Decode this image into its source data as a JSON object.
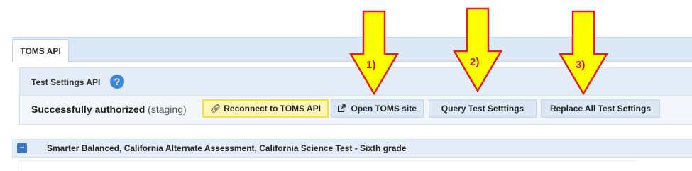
{
  "tabs": [
    {
      "label": "TOMS API"
    }
  ],
  "panel": {
    "title": "Test Settings API",
    "help_icon": "?",
    "auth_status": "Successfully authorized",
    "auth_env": "(staging)"
  },
  "buttons": {
    "reconnect": {
      "icon": "link-icon",
      "label": "Reconnect to TOMS API"
    },
    "open_site": {
      "icon": "external-link-icon",
      "label": "Open TOMS site"
    },
    "query": {
      "label": "Query Test Setttings"
    },
    "replace": {
      "label": "Replace All Test Settings"
    }
  },
  "accordion": {
    "toggle": "−",
    "title": "Smarter Balanced, California Alternate Assessment, California Science Test - Sixth grade"
  },
  "annotations": [
    {
      "label": "1)"
    },
    {
      "label": "2)"
    },
    {
      "label": "3)"
    }
  ],
  "colors": {
    "arrow_fill": "#ffff00",
    "arrow_stroke": "#e02020",
    "arrow_label": "#d41010",
    "reconnect_highlight": "#fff7b3"
  }
}
